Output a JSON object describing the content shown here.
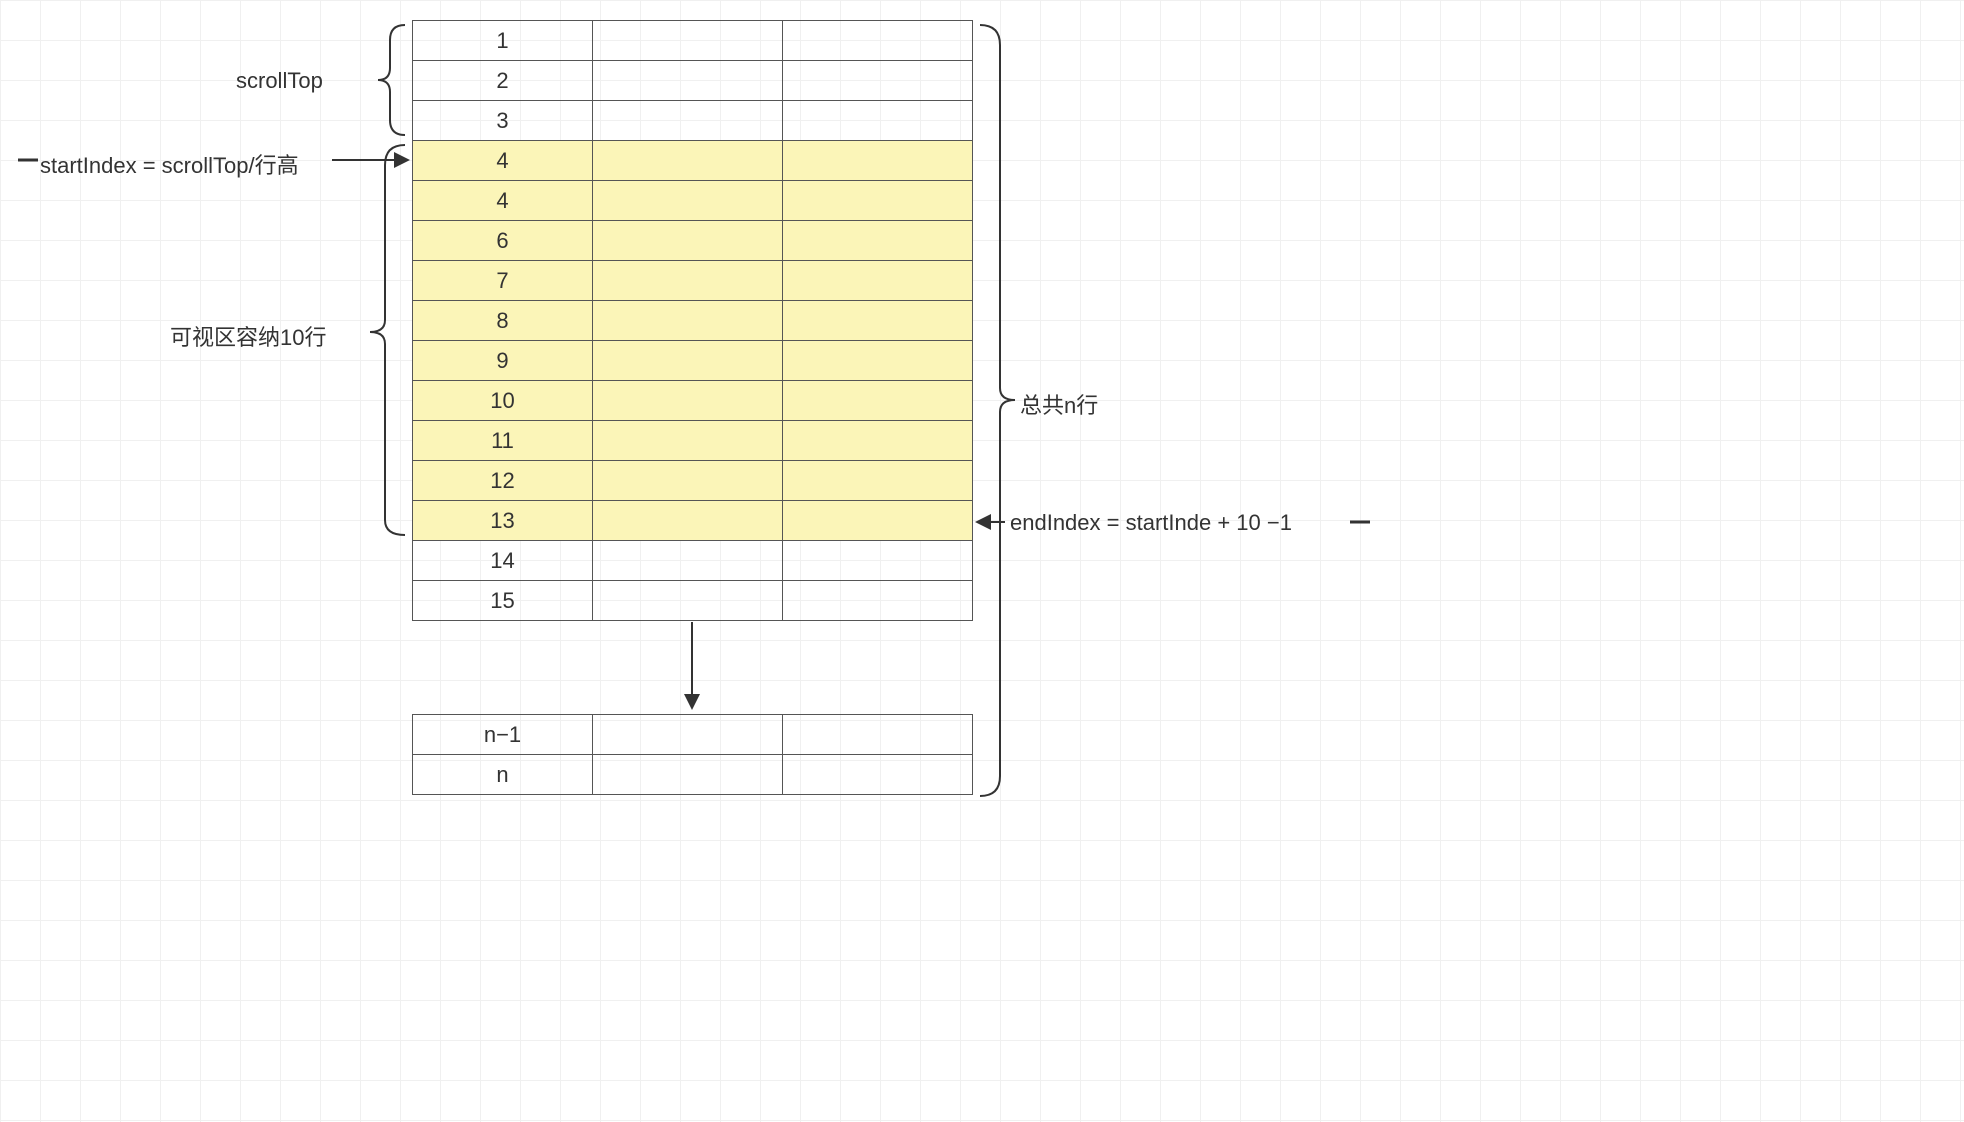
{
  "labels": {
    "scrollTop": "scrollTop",
    "startIndex": "startIndex = scrollTop/行高",
    "visibleRows": "可视区容纳10行",
    "totalRows": "总共n行",
    "endIndex": "endIndex = startInde + 10 −1"
  },
  "rows_main": [
    {
      "num": "1",
      "hl": false
    },
    {
      "num": "2",
      "hl": false
    },
    {
      "num": "3",
      "hl": false
    },
    {
      "num": "4",
      "hl": true
    },
    {
      "num": "4",
      "hl": true
    },
    {
      "num": "6",
      "hl": true
    },
    {
      "num": "7",
      "hl": true
    },
    {
      "num": "8",
      "hl": true
    },
    {
      "num": "9",
      "hl": true
    },
    {
      "num": "10",
      "hl": true
    },
    {
      "num": "11",
      "hl": true
    },
    {
      "num": "12",
      "hl": true
    },
    {
      "num": "13",
      "hl": true
    },
    {
      "num": "14",
      "hl": false
    },
    {
      "num": "15",
      "hl": false
    }
  ],
  "rows_footer": [
    {
      "num": "n−1"
    },
    {
      "num": "n"
    }
  ]
}
